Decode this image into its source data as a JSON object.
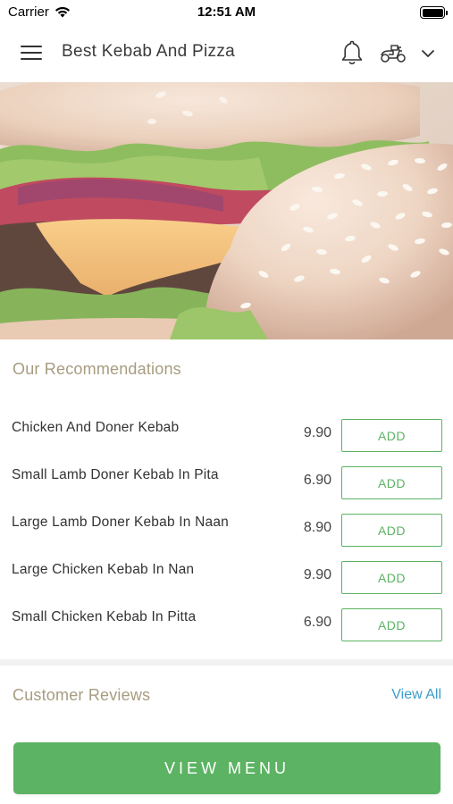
{
  "status_bar": {
    "carrier": "Carrier",
    "time": "12:51 AM",
    "icons": [
      "wifi-icon",
      "battery-icon"
    ]
  },
  "header": {
    "title": "Best Kebab And Pizza",
    "icons": [
      "menu-icon",
      "bell-icon",
      "scooter-icon",
      "chevron-down-icon"
    ]
  },
  "hero": {
    "image": "burger-photo"
  },
  "recommendations": {
    "title": "Our Recommendations",
    "items": [
      {
        "name": "Chicken And Doner Kebab",
        "price": "9.90",
        "button": "ADD"
      },
      {
        "name": "Small Lamb Doner Kebab In Pita",
        "price": "6.90",
        "button": "ADD"
      },
      {
        "name": "Large Lamb Doner Kebab In Naan",
        "price": "8.90",
        "button": "ADD"
      },
      {
        "name": "Large Chicken Kebab In Nan",
        "price": "9.90",
        "button": "ADD"
      },
      {
        "name": "Small Chicken Kebab In Pitta",
        "price": "6.90",
        "button": "ADD"
      }
    ]
  },
  "reviews": {
    "title": "Customer Reviews",
    "view_all": "View All"
  },
  "footer": {
    "view_menu": "VIEW MENU"
  },
  "colors": {
    "accent_green": "#5cb363",
    "section_title": "#a79c80",
    "link_blue": "#3a9ec9"
  }
}
